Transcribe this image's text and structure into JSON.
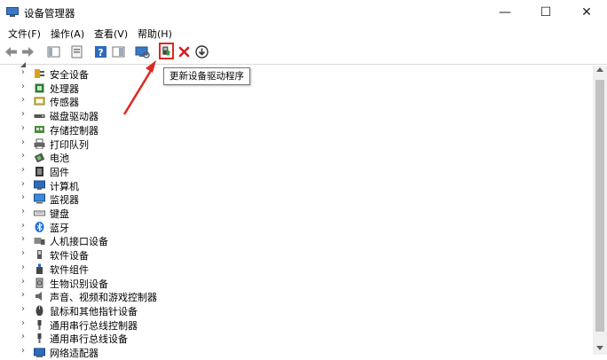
{
  "window": {
    "title": "设备管理器",
    "min_glyph": "—",
    "max_glyph": "☐",
    "close_glyph": "✕"
  },
  "menu": [
    {
      "label": "文件(F)"
    },
    {
      "label": "操作(A)"
    },
    {
      "label": "查看(V)"
    },
    {
      "label": "帮助(H)"
    }
  ],
  "toolbar": {
    "buttons": [
      "back-icon",
      "forward-icon",
      "properties-view-icon",
      "properties-icon",
      "help-icon",
      "device-list-icon",
      "scan-hardware-icon",
      "update-driver-icon",
      "uninstall-icon",
      "disable-download-icon"
    ],
    "active_button": "update-driver-icon",
    "tooltip": "更新设备驱动程序"
  },
  "tree": {
    "items": [
      {
        "label": "安全设备",
        "icon": "security-device-icon"
      },
      {
        "label": "处理器",
        "icon": "processor-icon"
      },
      {
        "label": "传感器",
        "icon": "sensor-icon"
      },
      {
        "label": "磁盘驱动器",
        "icon": "disk-drive-icon"
      },
      {
        "label": "存储控制器",
        "icon": "storage-controller-icon"
      },
      {
        "label": "打印队列",
        "icon": "printer-icon"
      },
      {
        "label": "电池",
        "icon": "battery-icon"
      },
      {
        "label": "固件",
        "icon": "firmware-icon"
      },
      {
        "label": "计算机",
        "icon": "computer-icon"
      },
      {
        "label": "监视器",
        "icon": "monitor-icon"
      },
      {
        "label": "键盘",
        "icon": "keyboard-icon"
      },
      {
        "label": "蓝牙",
        "icon": "bluetooth-icon"
      },
      {
        "label": "人机接口设备",
        "icon": "hid-icon"
      },
      {
        "label": "软件设备",
        "icon": "software-device-icon"
      },
      {
        "label": "软件组件",
        "icon": "software-component-icon"
      },
      {
        "label": "生物识别设备",
        "icon": "biometric-icon"
      },
      {
        "label": "声音、视频和游戏控制器",
        "icon": "sound-icon"
      },
      {
        "label": "鼠标和其他指针设备",
        "icon": "mouse-icon"
      },
      {
        "label": "通用串行总线控制器",
        "icon": "usb-icon"
      },
      {
        "label": "通用串行总线设备",
        "icon": "usb-icon"
      },
      {
        "label": "网络适配器",
        "icon": "network-adapter-icon"
      }
    ],
    "expand_glyph": "›"
  },
  "colors": {
    "annotation_red": "#e0281e",
    "toolbar_border": "#dcdcdc"
  }
}
